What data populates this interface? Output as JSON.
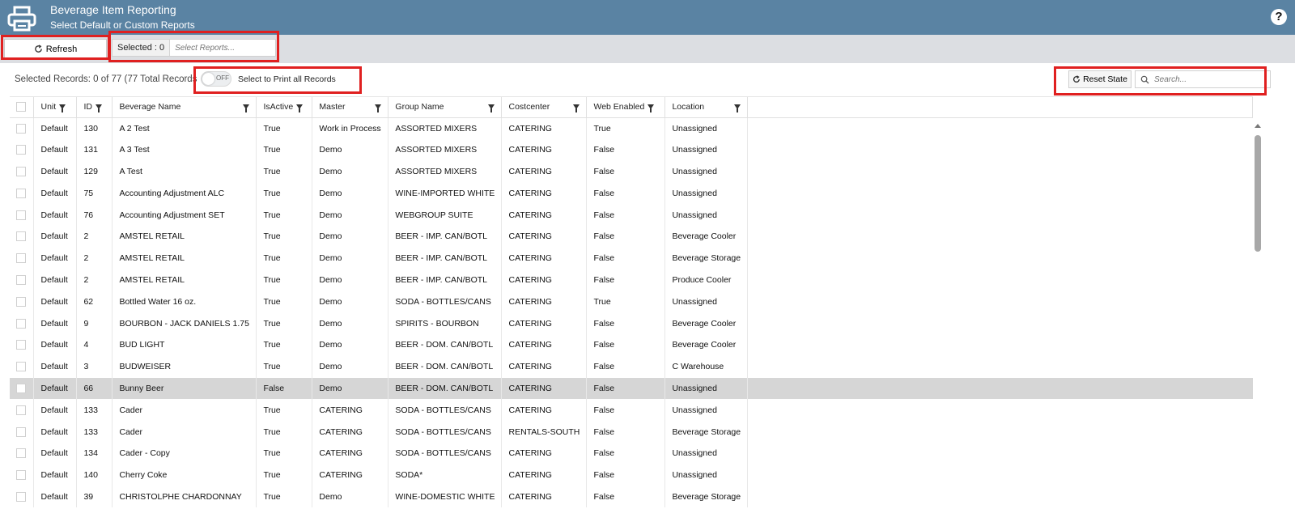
{
  "header": {
    "title": "Beverage Item Reporting",
    "subtitle": "Select Default or Custom Reports",
    "help_label": "?",
    "bg_color": "#5a83a3"
  },
  "toolbar": {
    "refresh_label": "Refresh",
    "selected_label": "Selected : 0",
    "reports_placeholder": "Select Reports..."
  },
  "records": {
    "summary": "Selected Records: 0 of 77 (77 Total Records",
    "toggle_state": "OFF",
    "print_all_label": "Select to Print all Records",
    "reset_label": "Reset State",
    "search_placeholder": "Search..."
  },
  "table": {
    "columns": [
      "Unit",
      "ID",
      "Beverage Name",
      "IsActive",
      "Master",
      "Group Name",
      "Costcenter",
      "Web Enabled",
      "Location"
    ],
    "rows": [
      [
        "Default",
        "130",
        "A 2 Test",
        "True",
        "Work in Process",
        "ASSORTED MIXERS",
        "CATERING",
        "True",
        "Unassigned"
      ],
      [
        "Default",
        "131",
        "A 3 Test",
        "True",
        "Demo",
        "ASSORTED MIXERS",
        "CATERING",
        "False",
        "Unassigned"
      ],
      [
        "Default",
        "129",
        "A Test",
        "True",
        "Demo",
        "ASSORTED MIXERS",
        "CATERING",
        "False",
        "Unassigned"
      ],
      [
        "Default",
        "75",
        "Accounting Adjustment ALC",
        "True",
        "Demo",
        "WINE-IMPORTED WHITE",
        "CATERING",
        "False",
        "Unassigned"
      ],
      [
        "Default",
        "76",
        "Accounting Adjustment SET",
        "True",
        "Demo",
        "WEBGROUP SUITE",
        "CATERING",
        "False",
        "Unassigned"
      ],
      [
        "Default",
        "2",
        "AMSTEL RETAIL",
        "True",
        "Demo",
        "BEER - IMP. CAN/BOTL",
        "CATERING",
        "False",
        "Beverage Cooler"
      ],
      [
        "Default",
        "2",
        "AMSTEL RETAIL",
        "True",
        "Demo",
        "BEER - IMP. CAN/BOTL",
        "CATERING",
        "False",
        "Beverage Storage"
      ],
      [
        "Default",
        "2",
        "AMSTEL RETAIL",
        "True",
        "Demo",
        "BEER - IMP. CAN/BOTL",
        "CATERING",
        "False",
        "Produce Cooler"
      ],
      [
        "Default",
        "62",
        "Bottled Water 16 oz.",
        "True",
        "Demo",
        "SODA - BOTTLES/CANS",
        "CATERING",
        "True",
        "Unassigned"
      ],
      [
        "Default",
        "9",
        "BOURBON - JACK DANIELS 1.75",
        "True",
        "Demo",
        "SPIRITS - BOURBON",
        "CATERING",
        "False",
        "Beverage Cooler"
      ],
      [
        "Default",
        "4",
        "BUD LIGHT",
        "True",
        "Demo",
        "BEER - DOM. CAN/BOTL",
        "CATERING",
        "False",
        "Beverage Cooler"
      ],
      [
        "Default",
        "3",
        "BUDWEISER",
        "True",
        "Demo",
        "BEER - DOM. CAN/BOTL",
        "CATERING",
        "False",
        "C Warehouse"
      ],
      [
        "Default",
        "66",
        "Bunny Beer",
        "False",
        "Demo",
        "BEER - DOM. CAN/BOTL",
        "CATERING",
        "False",
        "Unassigned"
      ],
      [
        "Default",
        "133",
        "Cader",
        "True",
        "CATERING",
        "SODA - BOTTLES/CANS",
        "CATERING",
        "False",
        "Unassigned"
      ],
      [
        "Default",
        "133",
        "Cader",
        "True",
        "CATERING",
        "SODA - BOTTLES/CANS",
        "RENTALS-SOUTH",
        "False",
        "Beverage Storage"
      ],
      [
        "Default",
        "134",
        "Cader - Copy",
        "True",
        "CATERING",
        "SODA - BOTTLES/CANS",
        "CATERING",
        "False",
        "Unassigned"
      ],
      [
        "Default",
        "140",
        "Cherry Coke",
        "True",
        "CATERING",
        "SODA*",
        "CATERING",
        "False",
        "Unassigned"
      ],
      [
        "Default",
        "39",
        "CHRISTOLPHE CHARDONNAY",
        "True",
        "Demo",
        "WINE-DOMESTIC WHITE",
        "CATERING",
        "False",
        "Beverage Storage"
      ]
    ],
    "highlight_row": 12
  }
}
